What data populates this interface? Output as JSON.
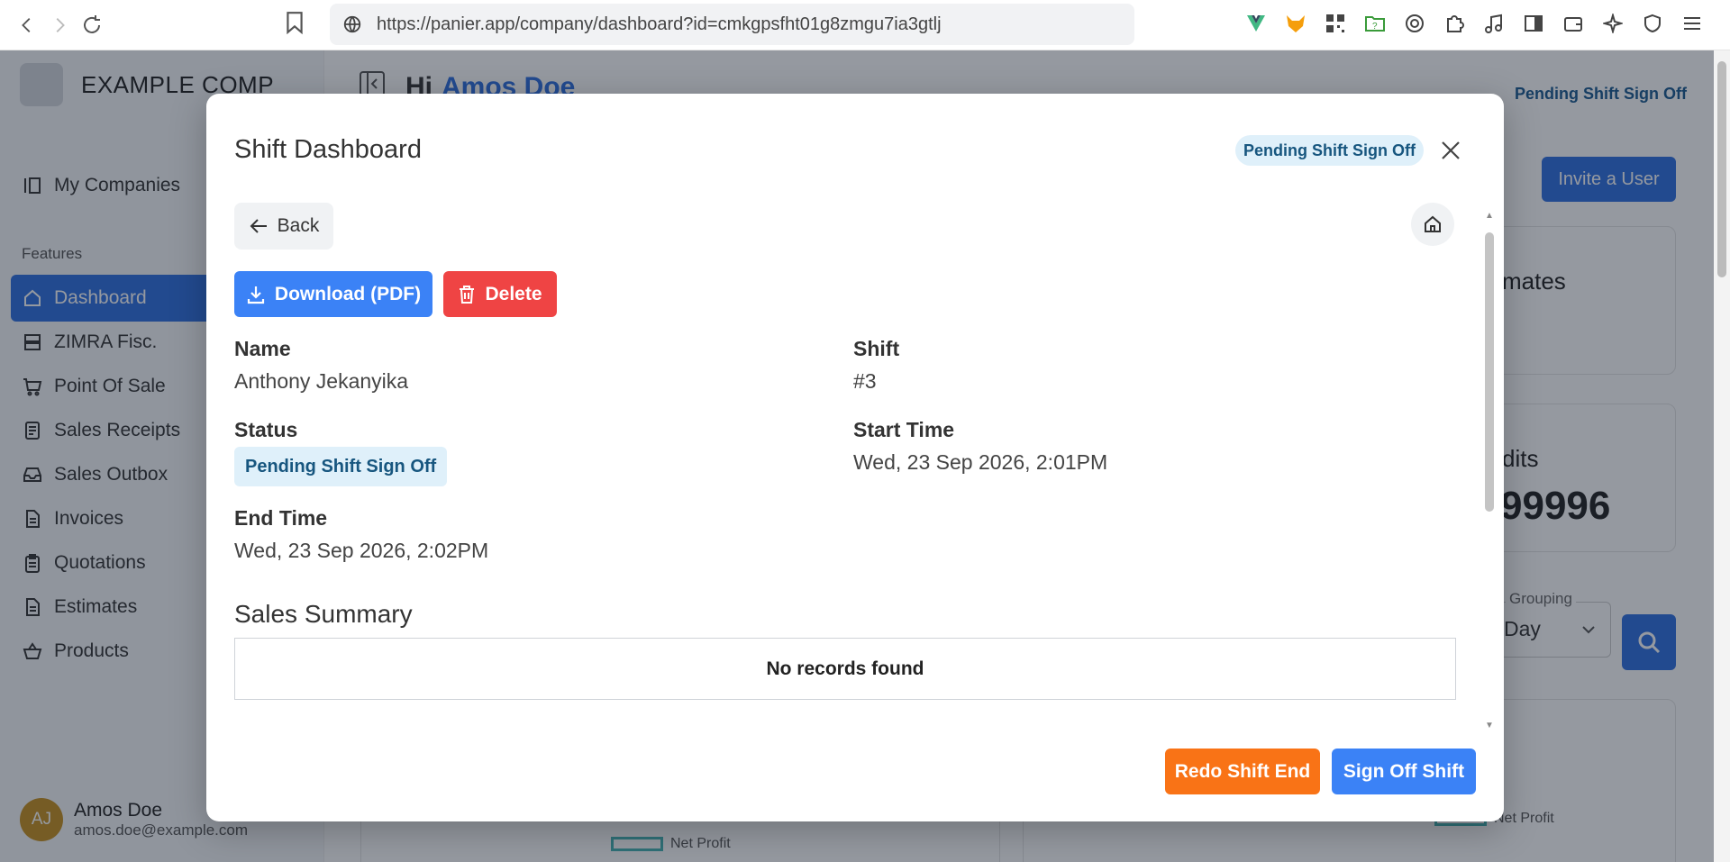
{
  "browser": {
    "url": "https://panier.app/company/dashboard?id=cmkgpsfht01g8zmgu7ia3gtlj"
  },
  "company": {
    "name": "EXAMPLE COMP"
  },
  "sidebar": {
    "my_companies": "My Companies",
    "features_heading": "Features",
    "items": [
      {
        "label": "Dashboard",
        "icon": "home-icon",
        "active": true
      },
      {
        "label": "ZIMRA Fisc.",
        "icon": "server-icon"
      },
      {
        "label": "Point Of Sale",
        "icon": "cart-icon"
      },
      {
        "label": "Sales Receipts",
        "icon": "receipt-icon"
      },
      {
        "label": "Sales Outbox",
        "icon": "inbox-icon"
      },
      {
        "label": "Invoices",
        "icon": "document-icon"
      },
      {
        "label": "Quotations",
        "icon": "clipboard-icon"
      },
      {
        "label": "Estimates",
        "icon": "document-icon"
      },
      {
        "label": "Products",
        "icon": "basket-icon"
      }
    ],
    "user": {
      "initials": "AJ",
      "name": "Amos Doe",
      "email": "amos.doe@example.com"
    }
  },
  "main": {
    "greeting": "Hi",
    "user_name": "Amos Doe",
    "badge": "Pending Shift Sign Off",
    "invite_label": "Invite a User",
    "card1_text": "mates",
    "card2_text": "dits",
    "card2_value": "99996",
    "grouping_label": "Grouping",
    "grouping_value": "Day",
    "legend_net_profit": "Net Profit"
  },
  "modal": {
    "title": "Shift Dashboard",
    "badge": "Pending Shift Sign Off",
    "back_label": "Back",
    "download_label": "Download (PDF)",
    "delete_label": "Delete",
    "name_label": "Name",
    "name_value": "Anthony Jekanyika",
    "shift_label": "Shift",
    "shift_value": "#3",
    "status_label": "Status",
    "status_value": "Pending Shift Sign Off",
    "start_label": "Start Time",
    "start_value": "Wed, 23 Sep 2026, 2:01PM",
    "end_label": "End Time",
    "end_value": "Wed, 23 Sep 2026, 2:02PM",
    "sales_summary_title": "Sales Summary",
    "empty_message": "No records found",
    "redo_label": "Redo Shift End",
    "signoff_label": "Sign Off Shift"
  },
  "colors": {
    "primary": "#3b82f6",
    "danger": "#ef4444",
    "warning": "#f97316",
    "badge_bg": "#dff0fa",
    "badge_text": "#17567f"
  }
}
